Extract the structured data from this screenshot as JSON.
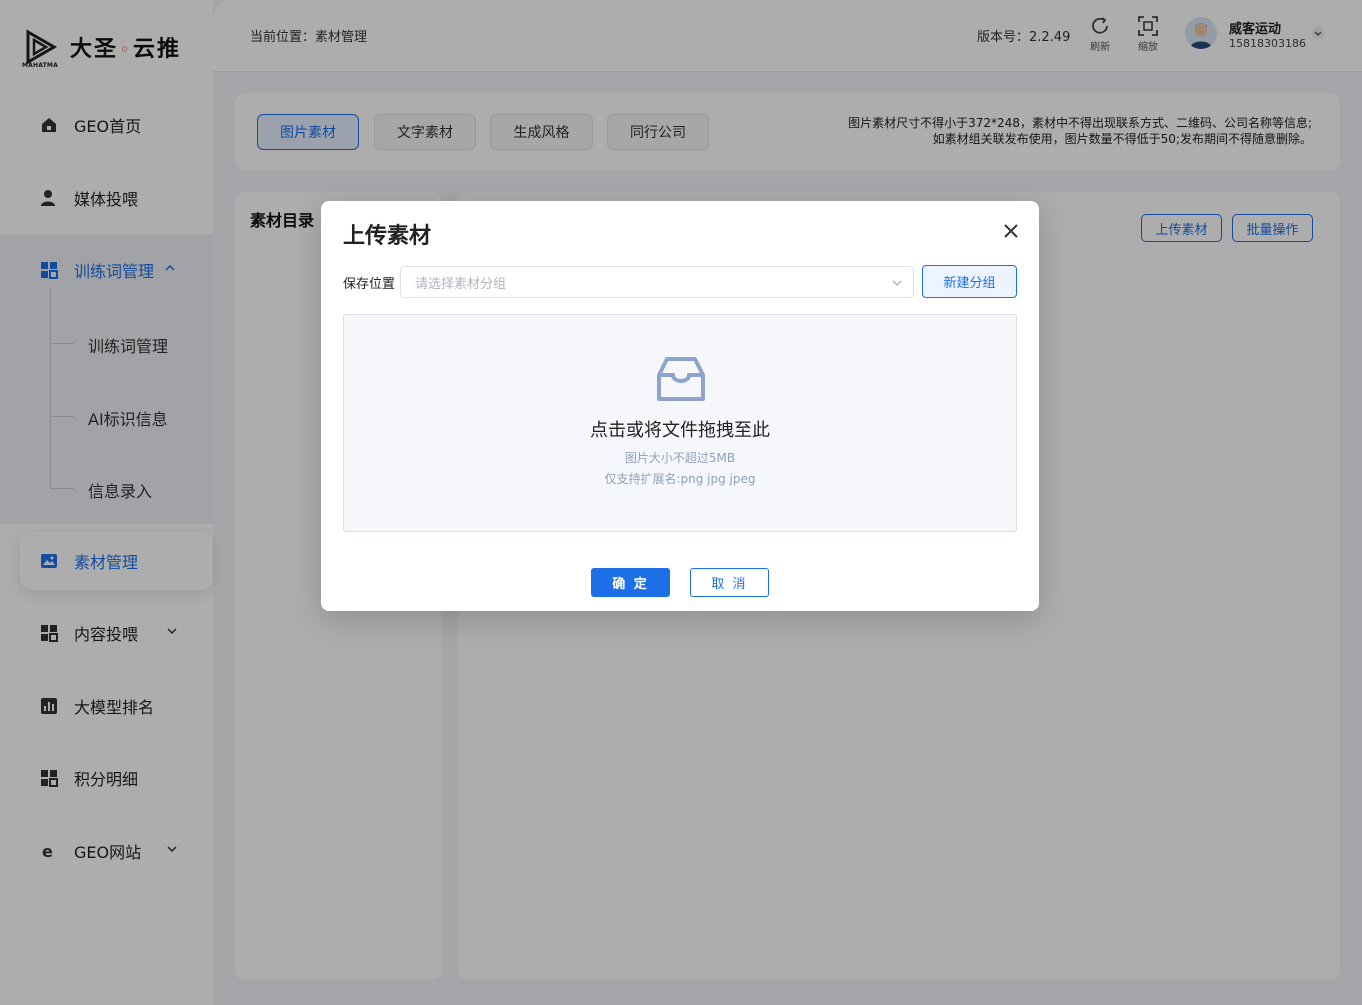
{
  "brand": {
    "name_left": "大圣",
    "name_right": "云推",
    "sub": "MAHATMA"
  },
  "sidebar": {
    "items": [
      {
        "label": "GEO首页",
        "icon": "home-icon"
      },
      {
        "label": "媒体投喂",
        "icon": "user-icon"
      },
      {
        "label": "训练词管理",
        "icon": "grid-icon",
        "expanded": true
      },
      {
        "label": "素材管理",
        "icon": "image-icon",
        "active": true
      },
      {
        "label": "内容投喂",
        "icon": "grid-icon"
      },
      {
        "label": "大模型排名",
        "icon": "bar-chart-icon"
      },
      {
        "label": "积分明细",
        "icon": "grid-icon"
      },
      {
        "label": "GEO网站",
        "icon": "ie-icon"
      }
    ],
    "sub_items": [
      "训练词管理",
      "AI标识信息",
      "信息录入"
    ]
  },
  "header": {
    "breadcrumb": "当前位置：素材管理",
    "version": "版本号：2.2.49",
    "refresh_label": "刷新",
    "zoom_label": "缩放",
    "user_name": "威客运动",
    "user_phone": "15818303186"
  },
  "tabs": [
    "图片素材",
    "文字素材",
    "生成风格",
    "同行公司"
  ],
  "notice": {
    "line1": "图片素材尺寸不得小于372*248，素材中不得出现联系方式、二维码、公司名称等信息;",
    "line2": "如素材组关联发布使用，图片数量不得低于50;发布期间不得随意删除。"
  },
  "left_panel": {
    "title": "素材目录"
  },
  "right_panel": {
    "upload_label": "上传素材",
    "batch_label": "批量操作"
  },
  "dialog": {
    "title": "上传素材",
    "field_label": "保存位置",
    "select_placeholder": "请选择素材分组",
    "new_group_label": "新建分组",
    "drop_main": "点击或将文件拖拽至此",
    "drop_hint1": "图片大小不超过5MB",
    "drop_hint2": "仅支持扩展名:png jpg jpeg",
    "ok_label": "确 定",
    "cancel_label": "取 消"
  },
  "colors": {
    "accent": "#1d6fe8",
    "overlay": "rgba(0,0,0,0.32)"
  }
}
